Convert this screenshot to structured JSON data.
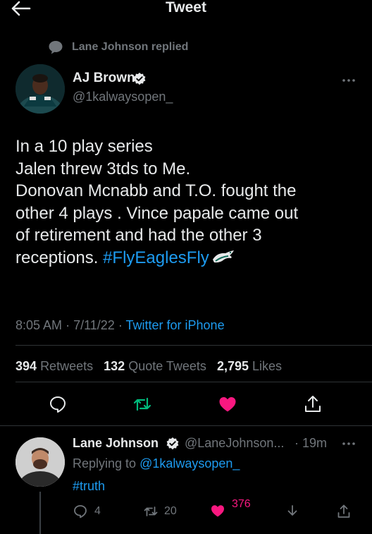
{
  "header": {
    "title": "Tweet",
    "back_icon": "back-arrow-icon"
  },
  "context": {
    "text": "Lane Johnson replied",
    "icon": "speech-bubble-icon"
  },
  "tweet": {
    "author_name": "AJ Brown",
    "author_handle": "@1kalwaysopen_",
    "lines": [
      "In a 10 play series",
      "Jalen threw 3tds to Me.",
      "Donovan Mcnabb and T.O. fought the",
      "other 4 plays . Vince papale came out",
      "of retirement and had the other 3"
    ],
    "last_line_text": "receptions. ",
    "hashtag": "#FlyEaglesFly",
    "emoji": "eagle-emoji",
    "time": "8:05 AM",
    "date": "7/11/22",
    "separator": "·",
    "source": "Twitter for iPhone",
    "stats": {
      "retweets_count": "394",
      "retweets_label": "Retweets",
      "quotes_count": "132",
      "quotes_label": "Quote Tweets",
      "likes_count": "2,795",
      "likes_label": "Likes"
    }
  },
  "reply": {
    "author_name": "Lane Johnson",
    "author_handle": "@LaneJohnson...",
    "time": "· 19m",
    "replying_label": "Replying to",
    "replying_handle": "@1kalwaysopen_",
    "text": "#truth",
    "reply_count": "4",
    "retweet_count": "20",
    "like_count": "376"
  },
  "colors": {
    "background": "#000000",
    "text": "#e7e9ea",
    "muted": "#71767b",
    "link": "#1d9bf0",
    "retweet_green": "#00ba7c",
    "like_pink": "#f91880",
    "divider": "#2f3336"
  }
}
